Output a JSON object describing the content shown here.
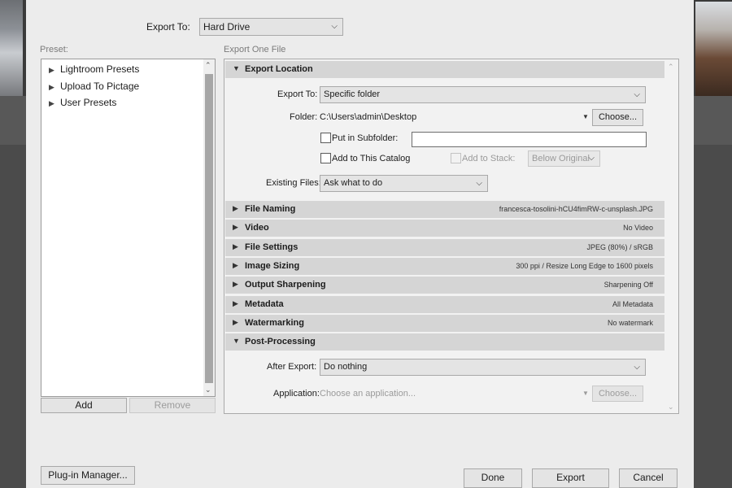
{
  "header": {
    "export_to_label": "Export To:",
    "export_to_value": "Hard Drive"
  },
  "preset": {
    "caption": "Preset:",
    "items": [
      {
        "label": "Lightroom Presets"
      },
      {
        "label": "Upload To Pictage"
      },
      {
        "label": "User Presets"
      }
    ],
    "add_label": "Add",
    "remove_label": "Remove"
  },
  "export_caption": "Export One File",
  "location": {
    "title": "Export Location",
    "export_to_label": "Export To:",
    "export_to_value": "Specific folder",
    "folder_label": "Folder:",
    "folder_path": "C:\\Users\\admin\\Desktop",
    "choose_label": "Choose...",
    "subfolder_label": "Put in Subfolder:",
    "subfolder_value": "",
    "catalog_label": "Add to This Catalog",
    "stack_label": "Add to Stack:",
    "stack_value": "Below Original",
    "existing_label": "Existing Files:",
    "existing_value": "Ask what to do"
  },
  "sections": [
    {
      "title": "File Naming",
      "summary": "francesca-tosolini-hCU4fimRW-c-unsplash.JPG"
    },
    {
      "title": "Video",
      "summary": "No Video"
    },
    {
      "title": "File Settings",
      "summary": "JPEG (80%) / sRGB"
    },
    {
      "title": "Image Sizing",
      "summary": "300 ppi / Resize Long Edge to 1600 pixels"
    },
    {
      "title": "Output Sharpening",
      "summary": "Sharpening Off"
    },
    {
      "title": "Metadata",
      "summary": "All Metadata"
    },
    {
      "title": "Watermarking",
      "summary": "No watermark"
    }
  ],
  "post": {
    "title": "Post-Processing",
    "after_label": "After Export:",
    "after_value": "Do nothing",
    "app_label": "Application:",
    "app_placeholder": "Choose an application...",
    "choose_label": "Choose..."
  },
  "footer": {
    "plugin_label": "Plug-in Manager...",
    "done_label": "Done",
    "export_label": "Export",
    "cancel_label": "Cancel"
  }
}
